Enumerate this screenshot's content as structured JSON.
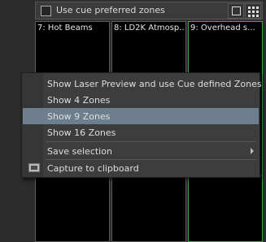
{
  "topbar": {
    "checkbox_label": "Use cue preferred zones"
  },
  "zones": [
    {
      "label": "7: Hot Beams"
    },
    {
      "label": "8: LD2K Atmosp..."
    },
    {
      "label": "9: Overhead s..."
    }
  ],
  "context_menu": {
    "items": [
      {
        "label": "Show Laser Preview and use Cue defined Zones"
      },
      {
        "label": "Show 4 Zones"
      },
      {
        "label": "Show 9 Zones",
        "highlighted": true
      },
      {
        "label": "Show 16 Zones"
      },
      {
        "label": "Save selection",
        "has_submenu": true
      },
      {
        "label": "Capture to clipboard",
        "icon": "clipboard-icon"
      }
    ]
  },
  "colors": {
    "active_zone_border": "#3fa63f",
    "menu_highlight": "#6d7f8f"
  }
}
